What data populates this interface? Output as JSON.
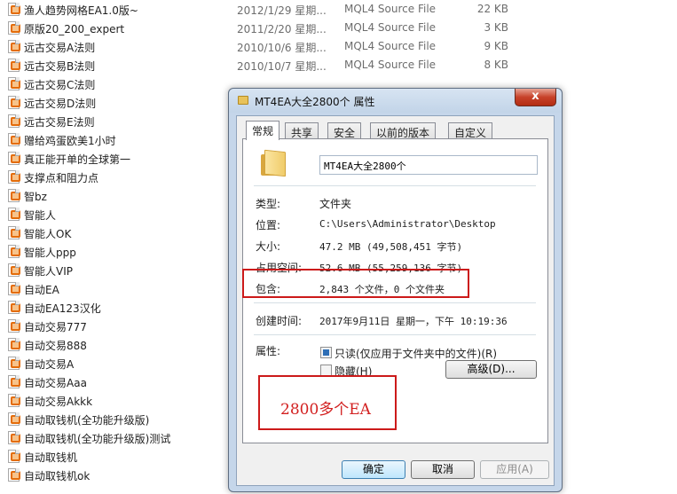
{
  "file_list": [
    {
      "name": "渔人趋势网格EA1.0版~",
      "date": "2012/1/29 星期...",
      "type": "MQL4 Source File",
      "size": "22 KB"
    },
    {
      "name": "原版20_200_expert",
      "date": "2011/2/20 星期...",
      "type": "MQL4 Source File",
      "size": "3 KB"
    },
    {
      "name": "远古交易A法则",
      "date": "2010/10/6 星期...",
      "type": "MQL4 Source File",
      "size": "9 KB"
    },
    {
      "name": "远古交易B法则",
      "date": "2010/10/7 星期...",
      "type": "MQL4 Source File",
      "size": "8 KB"
    },
    {
      "name": "远古交易C法则",
      "date": "",
      "type": "",
      "size": ""
    },
    {
      "name": "远古交易D法则",
      "date": "",
      "type": "",
      "size": ""
    },
    {
      "name": "远古交易E法则",
      "date": "",
      "type": "",
      "size": ""
    },
    {
      "name": "赠给鸡蛋欧美1小时",
      "date": "",
      "type": "",
      "size": ""
    },
    {
      "name": "真正能开单的全球第一",
      "date": "",
      "type": "",
      "size": ""
    },
    {
      "name": "支撑点和阻力点",
      "date": "",
      "type": "",
      "size": ""
    },
    {
      "name": "智bz",
      "date": "",
      "type": "",
      "size": ""
    },
    {
      "name": "智能人",
      "date": "",
      "type": "",
      "size": ""
    },
    {
      "name": "智能人OK",
      "date": "",
      "type": "",
      "size": ""
    },
    {
      "name": "智能人ppp",
      "date": "",
      "type": "",
      "size": ""
    },
    {
      "name": "智能人VIP",
      "date": "",
      "type": "",
      "size": ""
    },
    {
      "name": "自动EA",
      "date": "",
      "type": "",
      "size": ""
    },
    {
      "name": "自动EA123汉化",
      "date": "",
      "type": "",
      "size": ""
    },
    {
      "name": "自动交易777",
      "date": "",
      "type": "",
      "size": ""
    },
    {
      "name": "自动交易888",
      "date": "",
      "type": "",
      "size": ""
    },
    {
      "name": "自动交易A",
      "date": "",
      "type": "",
      "size": ""
    },
    {
      "name": "自动交易Aaa",
      "date": "",
      "type": "",
      "size": ""
    },
    {
      "name": "自动交易Akkk",
      "date": "",
      "type": "",
      "size": ""
    },
    {
      "name": "自动取钱机(全功能升级版)",
      "date": "",
      "type": "",
      "size": ""
    },
    {
      "name": "自动取钱机(全功能升级版)测试",
      "date": "",
      "type": "",
      "size": ""
    },
    {
      "name": "自动取钱机",
      "date": "",
      "type": "",
      "size": ""
    },
    {
      "name": "自动取钱机ok",
      "date": "",
      "type": "",
      "size": ""
    }
  ],
  "dialog": {
    "title": "MT4EA大全2800个 属性",
    "close_glyph": "x",
    "tabs": [
      "常规",
      "共享",
      "安全",
      "以前的版本",
      "自定义"
    ],
    "folder_name": "MT4EA大全2800个",
    "properties": [
      {
        "label": "类型:",
        "value": "文件夹",
        "cjk": true
      },
      {
        "label": "位置:",
        "value": "C:\\Users\\Administrator\\Desktop",
        "cjk": false
      },
      {
        "label": "大小:",
        "value": "47.2 MB (49,508,451 字节)",
        "cjk": false
      },
      {
        "label": "占用空间:",
        "value": "52.6 MB (55,259,136 字节)",
        "cjk": false
      },
      {
        "label": "包含:",
        "value": "2,843 个文件，0 个文件夹",
        "cjk": false
      }
    ],
    "created_label": "创建时间:",
    "created_value": "2017年9月11日 星期一，下午 10:19:36",
    "attributes_label": "属性:",
    "readonly_label": "只读(仅应用于文件夹中的文件)(R)",
    "readonly_checked": true,
    "hidden_label": "隐藏(H)",
    "hidden_checked": false,
    "advanced_button": "高级(D)...",
    "ok_button": "确定",
    "cancel_button": "取消",
    "apply_button": "应用(A)"
  },
  "annotation": {
    "text": "2800多个EA",
    "color": "#d21f1f"
  }
}
